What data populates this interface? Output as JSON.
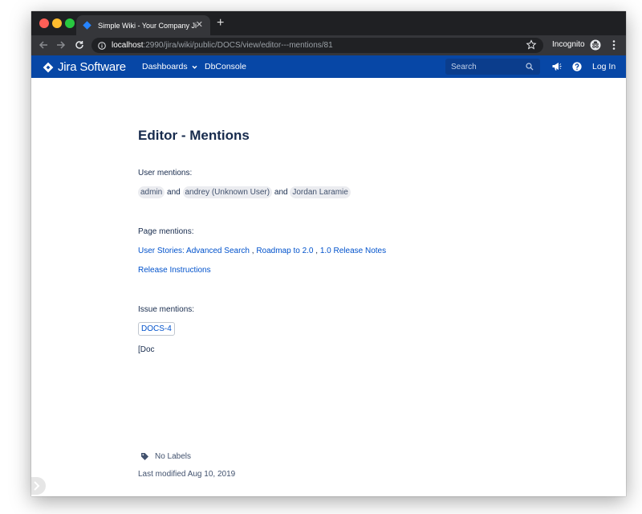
{
  "browser": {
    "tab_title": "Simple Wiki - Your Company Ji",
    "url_host": "localhost",
    "url_path": ":2990/jira/wiki/public/DOCS/view/editor---mentions/81",
    "incognito_label": "Incognito"
  },
  "header": {
    "logo_text": "Jira Software",
    "nav": {
      "dashboards": "Dashboards",
      "dbconsole": "DbConsole"
    },
    "search_placeholder": "Search",
    "login": "Log In"
  },
  "page": {
    "title": "Editor - Mentions",
    "user_mentions_label": "User mentions:",
    "user_mentions": [
      "admin",
      "andrey (Unknown User)",
      "Jordan Laramie"
    ],
    "and_word": "and",
    "page_mentions_label": "Page mentions:",
    "page_mentions": [
      "User Stories: Advanced Search",
      "Roadmap to 2.0",
      "1.0 Release Notes",
      "Release Instructions"
    ],
    "comma": ",",
    "issue_mentions_label": "Issue mentions:",
    "issue_key": "DOCS-4",
    "stray_text": "[Doc",
    "labels_text": "No Labels",
    "last_modified": "Last modified Aug 10, 2019"
  },
  "colors": {
    "header_bg": "#0747a6",
    "link": "#0052cc",
    "tab_strip": "#1f2023",
    "toolbar": "#35363a"
  }
}
